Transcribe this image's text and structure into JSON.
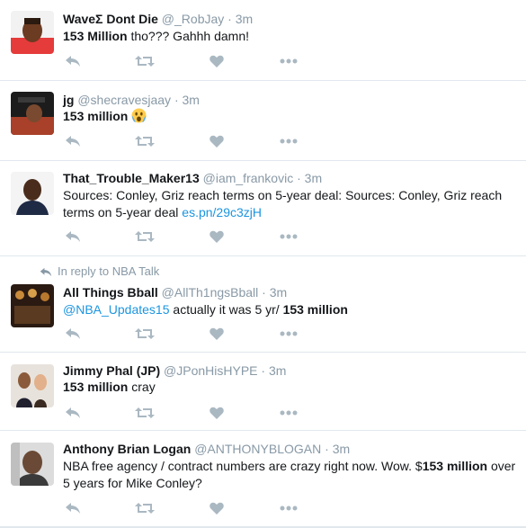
{
  "tweets": [
    {
      "name": "WaveΣ Dont Die",
      "handle": "@_RobJay",
      "time": "3m",
      "bold": "153 Million",
      "rest": " tho??? Gahhh damn!"
    },
    {
      "name": "jg",
      "handle": "@shecravesjaay",
      "time": "3m",
      "bold": "153 million",
      "rest": " "
    },
    {
      "name": "That_Trouble_Maker13",
      "handle": "@iam_frankovic",
      "time": "3m",
      "text": "Sources: Conley, Griz reach terms on 5-year deal: Sources: Conley, Griz reach terms on 5-year deal ",
      "link": "es.pn/29c3zjH"
    },
    {
      "reply_to": "In reply to NBA Talk",
      "name": "All Things Bball",
      "handle": "@AllTh1ngsBball",
      "time": "3m",
      "mention": "@NBA_Updates15",
      "mid": " actually it was 5 yr/ ",
      "bold": "153 million"
    },
    {
      "name": "Jimmy Phal (JP)",
      "handle": "@JPonHisHYPE",
      "time": "3m",
      "bold": "153 million",
      "rest": " cray"
    },
    {
      "name": "Anthony Brian Logan",
      "handle": "@ANTHONYBLOGAN",
      "time": "3m",
      "pre": "NBA free agency / contract numbers are crazy right now. Wow. $",
      "bold": "153 million",
      "post": " over 5 years for Mike Conley?"
    }
  ],
  "separator": "·",
  "icons": {
    "reply": "reply-icon",
    "retweet": "retweet-icon",
    "like": "heart-icon",
    "more": "more-icon",
    "emoji": "screaming-face-emoji"
  },
  "colors": {
    "meta": "#8899a6",
    "link": "#1b95e0",
    "icon": "#aab8c2",
    "divider": "#e1e8ed"
  }
}
